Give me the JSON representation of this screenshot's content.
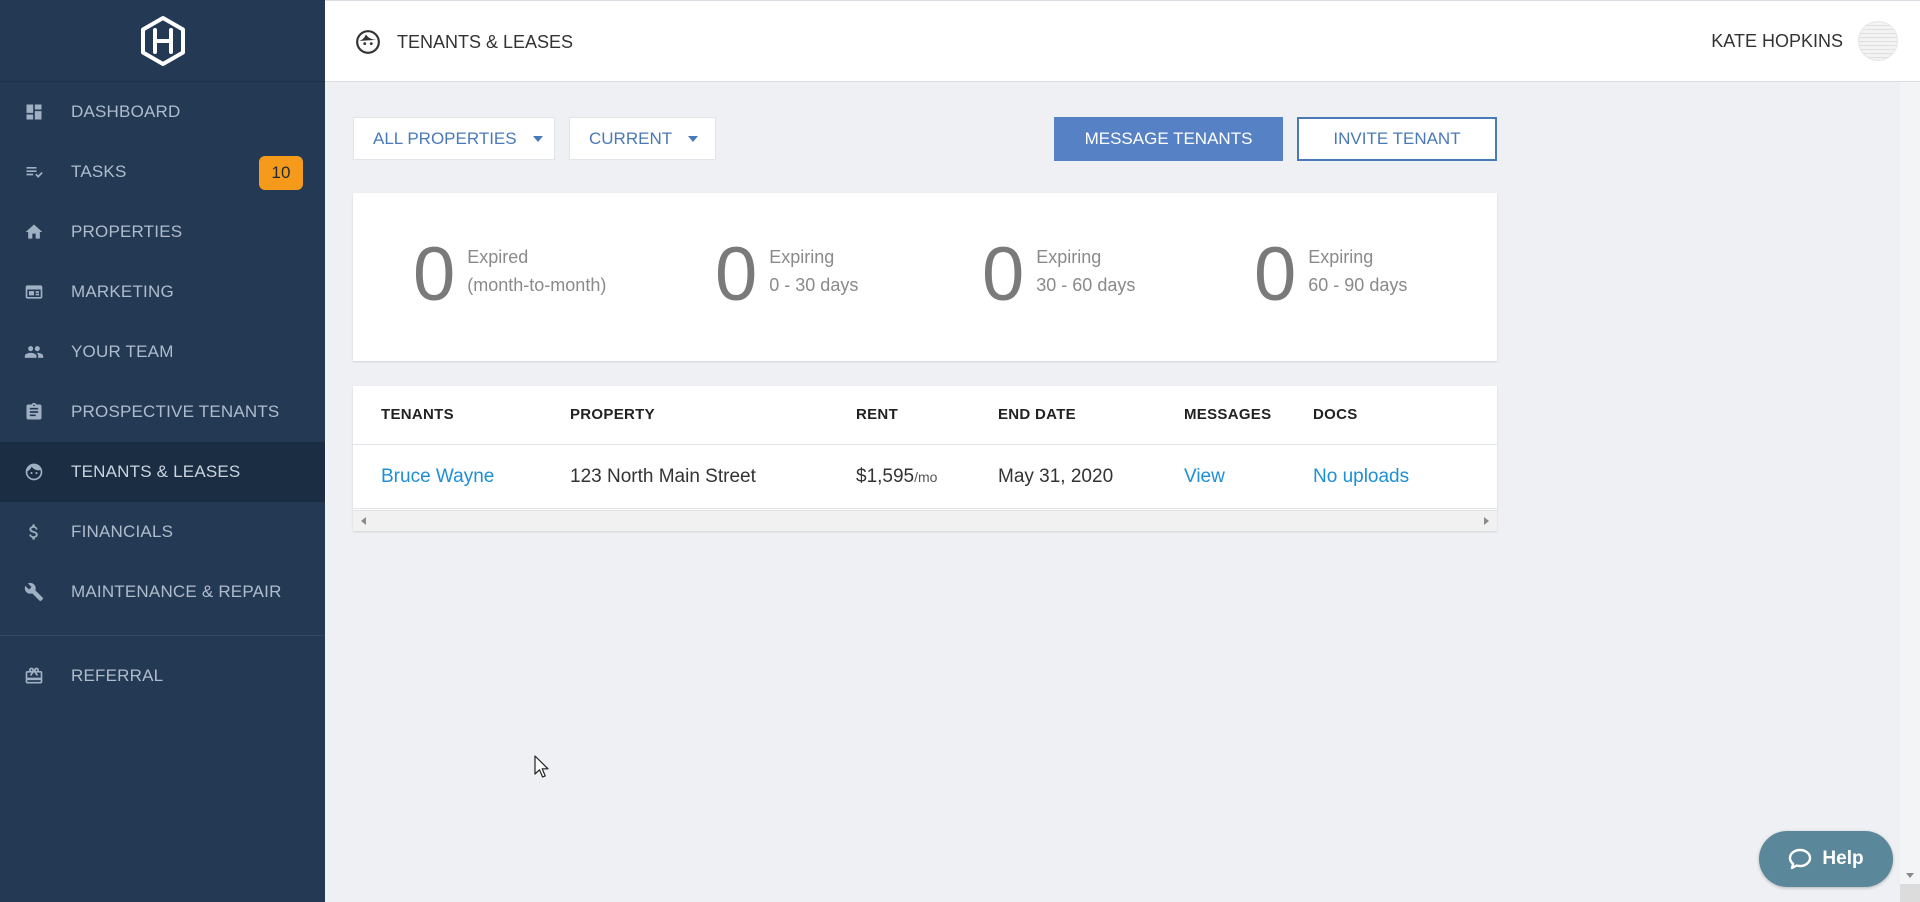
{
  "app": {
    "section_title": "TENANTS & LEASES",
    "user_name": "KATE HOPKINS",
    "colors": {
      "sidebar_bg": "#243a54",
      "accent": "#5682c5",
      "badge": "#f59a1b",
      "link": "#1d8fd6",
      "help": "#5a8799"
    }
  },
  "sidebar": {
    "logo_icon": "hexagon-h-logo",
    "items": [
      {
        "label": "DASHBOARD",
        "icon": "dashboard-icon"
      },
      {
        "label": "TASKS",
        "icon": "tasks-icon",
        "badge": "10"
      },
      {
        "label": "PROPERTIES",
        "icon": "home-icon"
      },
      {
        "label": "MARKETING",
        "icon": "marketing-icon"
      },
      {
        "label": "YOUR TEAM",
        "icon": "team-icon"
      },
      {
        "label": "PROSPECTIVE TENANTS",
        "icon": "clipboard-icon"
      },
      {
        "label": "TENANTS & LEASES",
        "icon": "face-icon",
        "active": true
      },
      {
        "label": "FINANCIALS",
        "icon": "dollar-icon"
      },
      {
        "label": "MAINTENANCE & REPAIR",
        "icon": "wrench-icon"
      }
    ],
    "secondary": [
      {
        "label": "REFERRAL",
        "icon": "gift-icon"
      }
    ]
  },
  "toolbar": {
    "property_filter": "ALL PROPERTIES",
    "status_filter": "CURRENT",
    "message_button": "MESSAGE TENANTS",
    "invite_button": "INVITE TENANT"
  },
  "stats": [
    {
      "count": "0",
      "line1": "Expired",
      "line2": "(month-to-month)"
    },
    {
      "count": "0",
      "line1": "Expiring",
      "line2": "0 - 30 days"
    },
    {
      "count": "0",
      "line1": "Expiring",
      "line2": "30 - 60 days"
    },
    {
      "count": "0",
      "line1": "Expiring",
      "line2": "60 - 90 days"
    }
  ],
  "table": {
    "headers": [
      "TENANTS",
      "PROPERTY",
      "RENT",
      "END DATE",
      "MESSAGES",
      "DOCS"
    ],
    "rows": [
      {
        "tenant": "Bruce Wayne",
        "property": "123 North Main Street",
        "rent": "$1,595",
        "rent_unit": "/mo",
        "end_date": "May 31, 2020",
        "messages": "View",
        "docs": "No uploads"
      }
    ]
  },
  "help": {
    "label": "Help",
    "icon": "chat-bubble-icon"
  }
}
